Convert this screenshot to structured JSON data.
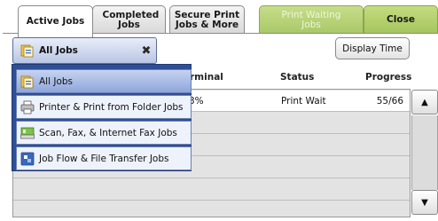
{
  "tabs": {
    "active_jobs": "Active Jobs",
    "completed_jobs": "Completed Jobs",
    "secure_print": "Secure Print Jobs & More",
    "print_waiting": "Print Waiting Jobs",
    "close": "Close"
  },
  "filter": {
    "selected": "All Jobs",
    "clear_glyph": "✖",
    "options": [
      {
        "label": "All Jobs",
        "icon": "all-jobs-icon",
        "selected": true
      },
      {
        "label": "Printer & Print from Folder Jobs",
        "icon": "printer-icon",
        "selected": false
      },
      {
        "label": "Scan, Fax, & Internet Fax Jobs",
        "icon": "scanner-icon",
        "selected": false
      },
      {
        "label": "Job Flow & File Transfer Jobs",
        "icon": "job-flow-icon",
        "selected": false
      }
    ]
  },
  "display_time_button": "Display Time",
  "columns": {
    "terminal": "rminal",
    "status": "Status",
    "progress": "Progress"
  },
  "rows": [
    {
      "terminal": "3%",
      "status": "Print Wait",
      "progress": "55/66"
    }
  ],
  "scroll": {
    "up": "▲",
    "down": "▼"
  },
  "colors": {
    "menu_bg": "#2e4f96",
    "tab_green": "#a9c867",
    "selected_item": "#8ea6dc"
  }
}
